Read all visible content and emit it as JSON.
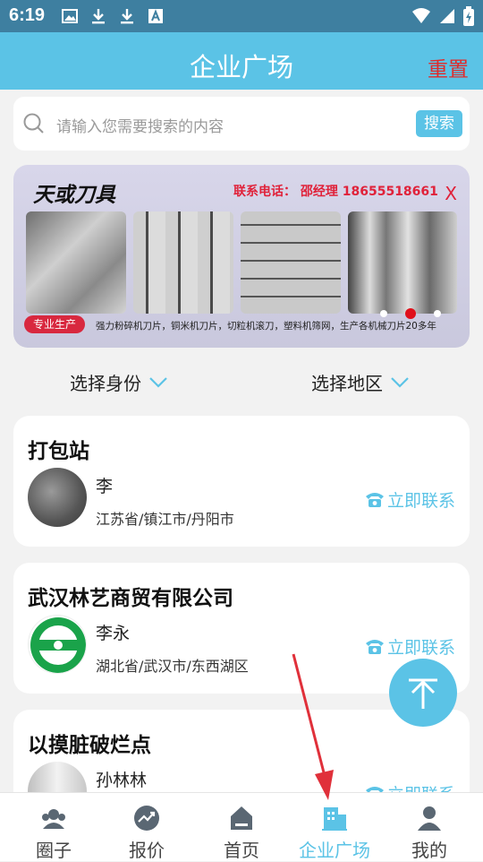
{
  "status": {
    "time": "6:19"
  },
  "header": {
    "title": "企业广场",
    "reset": "重置"
  },
  "search": {
    "placeholder": "请输入您需要搜索的内容",
    "button": "搜索"
  },
  "banner": {
    "brand": "天或刀具",
    "contact": "联系电话：  邵经理 18655518661",
    "close": "X",
    "tag": "专业生产",
    "desc": "强力粉碎机刀片，铜米机刀片，切粒机滚刀，塑料机筛网，生产各机械刀片20多年"
  },
  "filters": {
    "identity": "选择身份",
    "region": "选择地区"
  },
  "cards": [
    {
      "name": "打包站",
      "person": "李",
      "location": "江苏省/镇江市/丹阳市",
      "call": "立即联系"
    },
    {
      "name": "武汉林艺商贸有限公司",
      "person": "李永",
      "location": "湖北省/武汉市/东西湖区",
      "call": "立即联系"
    },
    {
      "name": "以摸脏破烂点",
      "person": "孙林林",
      "location": "",
      "call": "立即联系"
    }
  ],
  "nav": [
    {
      "label": "圈子",
      "icon": "circle-icon"
    },
    {
      "label": "报价",
      "icon": "trend-icon"
    },
    {
      "label": "首页",
      "icon": "home-icon"
    },
    {
      "label": "企业广场",
      "icon": "building-icon"
    },
    {
      "label": "我的",
      "icon": "user-icon"
    }
  ],
  "colors": {
    "accent": "#5bc3e6",
    "reset": "#e02b2b",
    "statusbar": "#3e7fa0"
  }
}
